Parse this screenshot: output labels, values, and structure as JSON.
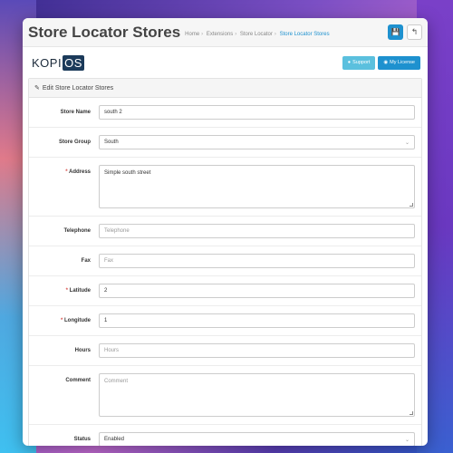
{
  "header": {
    "title": "Store Locator Stores",
    "breadcrumb": [
      "Home",
      "Extensions",
      "Store Locator",
      "Store Locator Stores"
    ]
  },
  "brand": {
    "logo_left": "KOPI",
    "logo_right": "OS",
    "support_label": "Support",
    "license_label": "My License"
  },
  "panel": {
    "heading": "Edit Store Locator Stores"
  },
  "form": {
    "store_name": {
      "label": "Store Name",
      "value": "south 2"
    },
    "store_group": {
      "label": "Store Group",
      "value": "South"
    },
    "address": {
      "label": "Address",
      "value": "Simple south street"
    },
    "telephone": {
      "label": "Telephone",
      "placeholder": "Telephone"
    },
    "fax": {
      "label": "Fax",
      "placeholder": "Fax"
    },
    "latitude": {
      "label": "Latitude",
      "value": "2"
    },
    "longitude": {
      "label": "Longitude",
      "value": "1"
    },
    "hours": {
      "label": "Hours",
      "placeholder": "Hours"
    },
    "comment": {
      "label": "Comment",
      "placeholder": "Comment"
    },
    "status": {
      "label": "Status",
      "value": "Enabled"
    }
  },
  "colors": {
    "primary": "#1e91cf",
    "info": "#5bc0de",
    "required": "#d9534f"
  }
}
